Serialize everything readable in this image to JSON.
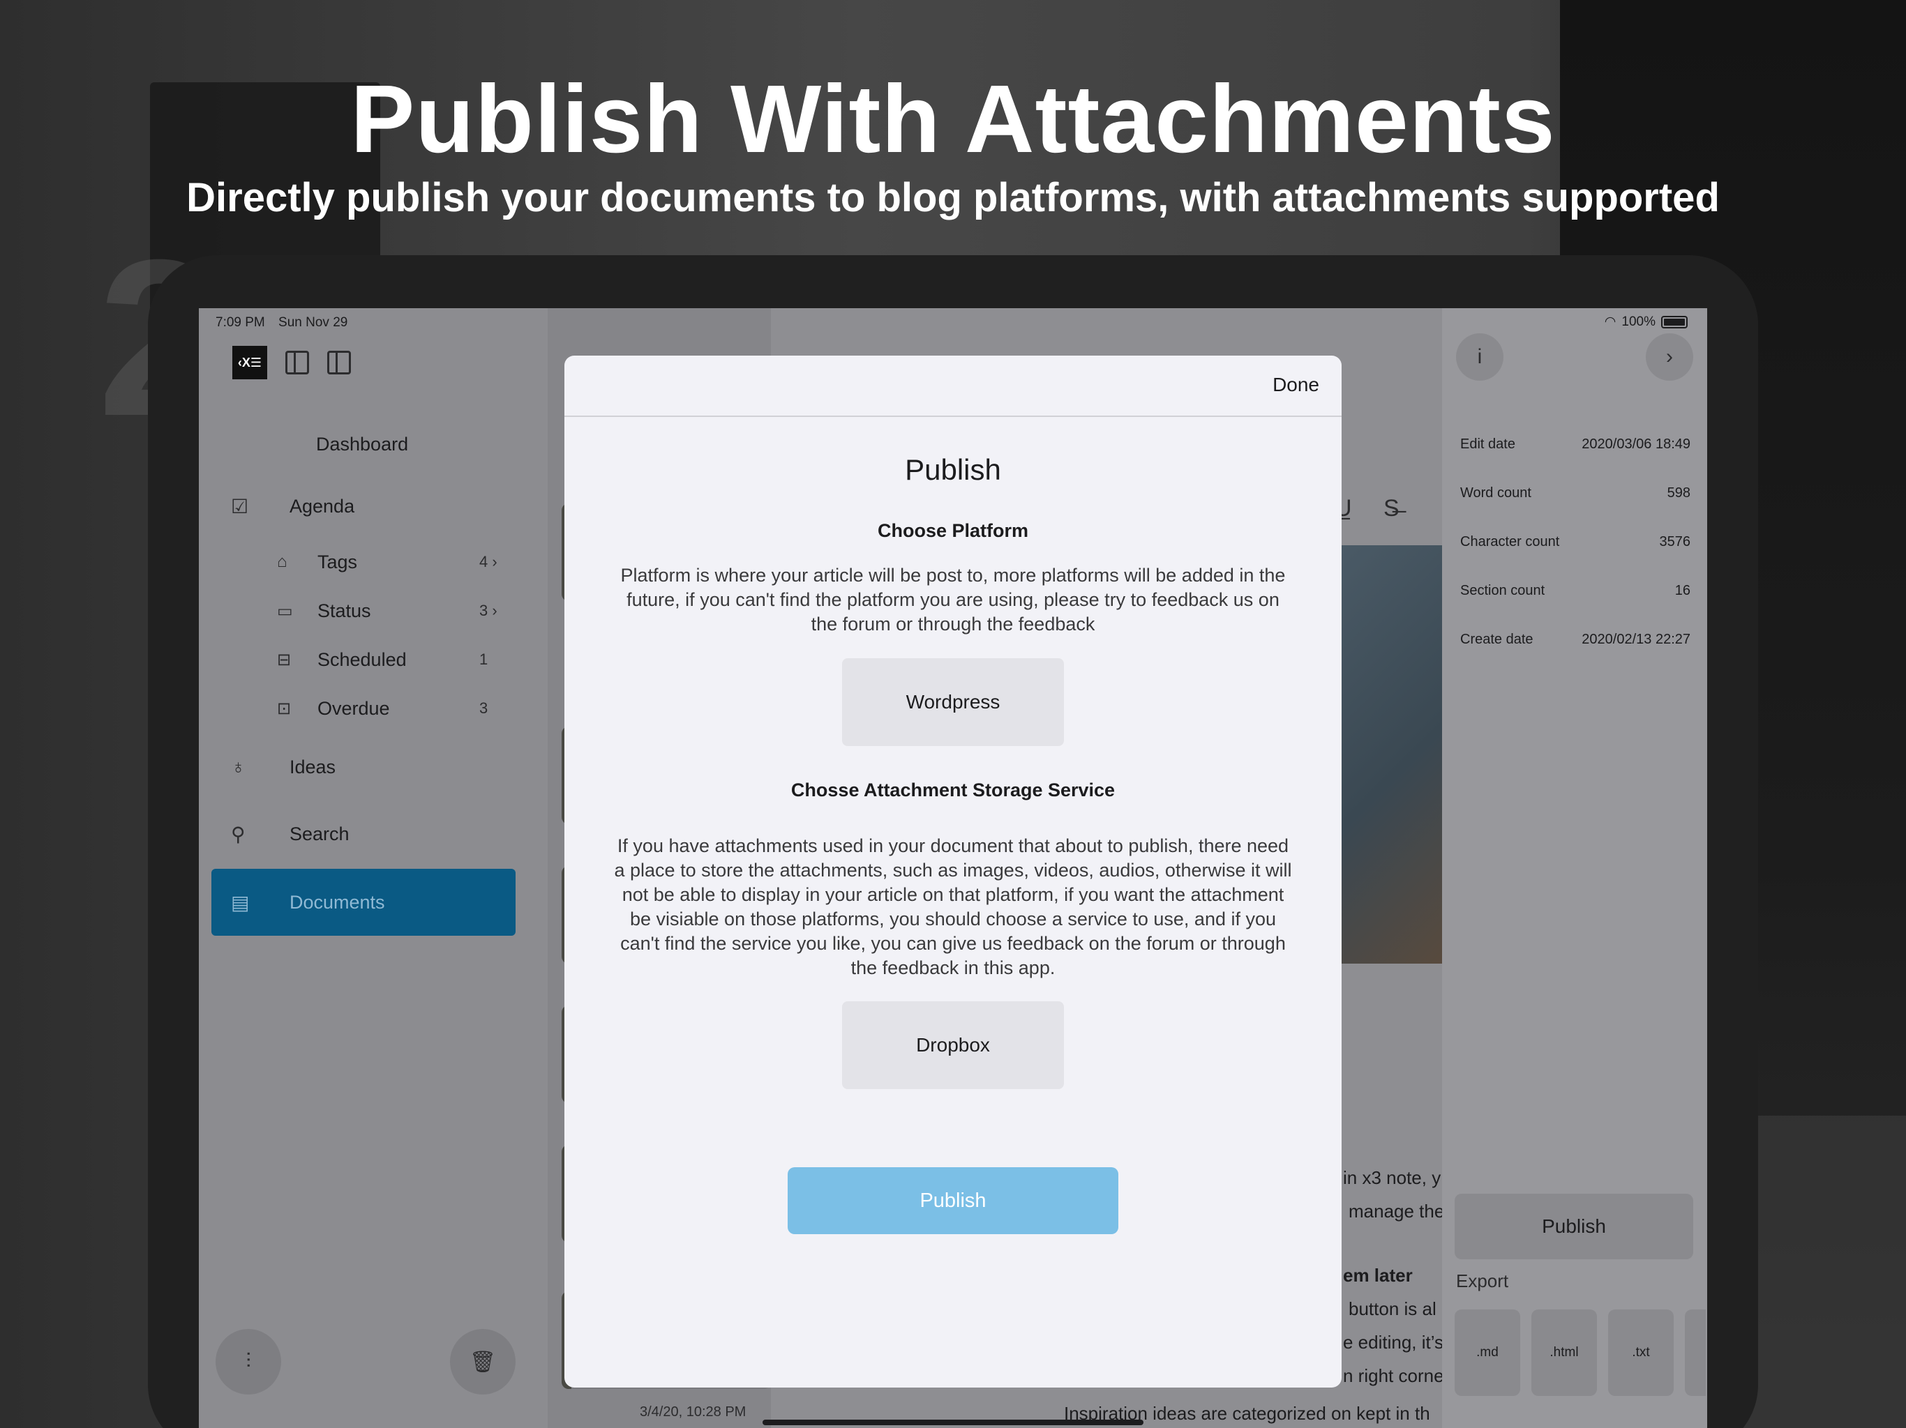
{
  "headline": "Publish With Attachments",
  "subhead": "Directly publish your documents to blog platforms, with attachments supported",
  "status_bar": {
    "time": "7:09 PM",
    "date": "Sun Nov 29",
    "battery": "100%"
  },
  "app_logo": "‹X☰",
  "sidebar": {
    "dashboard": "Dashboard",
    "agenda": "Agenda",
    "items": [
      {
        "label": "Tags",
        "count": "4 ›",
        "icon": "tag-icon"
      },
      {
        "label": "Status",
        "count": "3 ›",
        "icon": "status-icon"
      },
      {
        "label": "Scheduled",
        "count": "1",
        "icon": "scheduled-icon"
      },
      {
        "label": "Overdue",
        "count": "3",
        "icon": "overdue-icon"
      }
    ],
    "ideas": "Ideas",
    "search": "Search",
    "documents": "Documents"
  },
  "doclist": {
    "last_date": "3/4/20, 10:28 PM"
  },
  "editor": {
    "lines": [
      "in x3 note, y",
      "manage the",
      "em later",
      "button is al",
      "e editing, it’s",
      "n right corne",
      "Inspiration ideas are categorized on kept in th"
    ]
  },
  "inspector": {
    "info_label": "i",
    "meta": [
      {
        "label": "Edit date",
        "value": "2020/03/06 18:49"
      },
      {
        "label": "Word count",
        "value": "598"
      },
      {
        "label": "Character count",
        "value": "3576"
      },
      {
        "label": "Section count",
        "value": "16"
      },
      {
        "label": "Create date",
        "value": "2020/02/13 22:27"
      }
    ],
    "publish": "Publish",
    "export_label": "Export",
    "export_formats": [
      ".md",
      ".html",
      ".txt"
    ]
  },
  "modal": {
    "done": "Done",
    "title": "Publish",
    "platform_heading": "Choose Platform",
    "platform_text": "Platform is where your article will be post to, more platforms will be added in the future, if you can't find the platform you are using, please try to feedback us on the forum or through the feedback",
    "platform_option": "Wordpress",
    "storage_heading": "Chosse Attachment Storage Service",
    "storage_text": "If you have attachments used in your document that about to publish, there need a place to store the attachments, such as images, videos, audios, otherwise it will not be able to display in your article on that platform, if you want the attachment be visiable on those platforms, you should choose a service to use, and if you can't find the service you like, you can give us feedback on the forum or through the feedback in this app.",
    "storage_option": "Dropbox",
    "publish": "Publish"
  },
  "colors": {
    "accent": "#0a5a84",
    "publish_button": "#7bbfe6",
    "modal_bg": "#f2f2f7"
  }
}
